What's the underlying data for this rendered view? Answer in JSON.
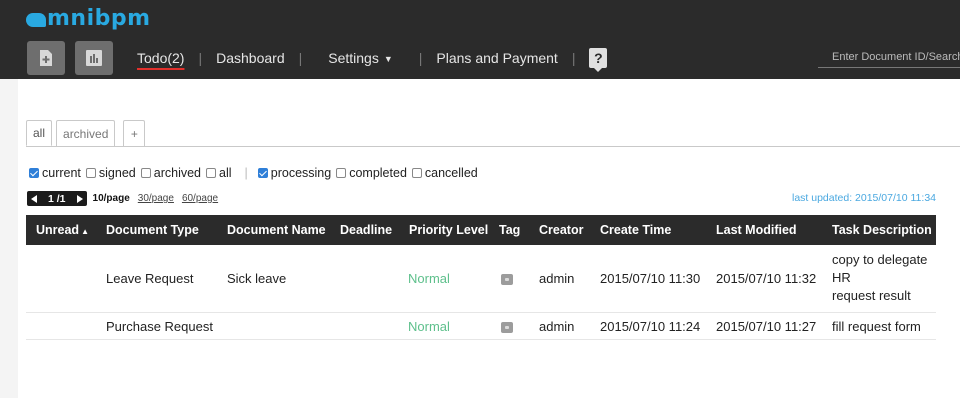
{
  "app": {
    "logo_text": "mnibpm",
    "brand_color": "#29a9e1"
  },
  "header": {
    "new_doc_icon": "new-document-icon",
    "report_icon": "bar-chart-icon",
    "nav": [
      {
        "label": "Todo(2)",
        "active": true
      },
      {
        "label": "Dashboard"
      },
      {
        "label": "Settings"
      },
      {
        "label": "Plans and Payment"
      }
    ],
    "help_label": "?",
    "search_placeholder": "Enter Document ID/Search"
  },
  "tabs": [
    {
      "label": "all",
      "active": true
    },
    {
      "label": "archived"
    },
    {
      "label": "+"
    }
  ],
  "filters": {
    "group1": [
      {
        "label": "current",
        "checked": true
      },
      {
        "label": "signed",
        "checked": false
      },
      {
        "label": "archived",
        "checked": false
      },
      {
        "label": "all",
        "checked": false
      }
    ],
    "group2": [
      {
        "label": "processing",
        "checked": true
      },
      {
        "label": "completed",
        "checked": false
      },
      {
        "label": "cancelled",
        "checked": false
      }
    ]
  },
  "pager": {
    "current": "1",
    "total": "/1",
    "per_page": "10/page",
    "options": [
      "30/page",
      "60/page"
    ]
  },
  "last_updated": "last updated: 2015/07/10 11:34",
  "table": {
    "columns": [
      "Unread",
      "Document Type",
      "Document Name",
      "Deadline",
      "Priority Level",
      "Tag",
      "Creator",
      "Create Time",
      "Last Modified",
      "Task Description"
    ],
    "sort_indicator": "▲",
    "rows": [
      {
        "unread": "",
        "document_type": "Leave Request",
        "document_name": "Sick leave",
        "deadline": "",
        "priority": "Normal",
        "creator": "admin",
        "create_time": "2015/07/10 11:30",
        "last_modified": "2015/07/10 11:32",
        "task_description": [
          "copy to delegate",
          "HR",
          "request result"
        ]
      },
      {
        "unread": "",
        "document_type": "Purchase Request",
        "document_name": "",
        "deadline": "",
        "priority": "Normal",
        "creator": "admin",
        "create_time": "2015/07/10 11:24",
        "last_modified": "2015/07/10 11:27",
        "task_description": [
          "fill request form"
        ]
      }
    ]
  },
  "colors": {
    "header_bg": "#2b2b2b",
    "priority_normal": "#5ec08c",
    "updated_text": "#4aa8e0",
    "active_underline": "#e2302c"
  }
}
